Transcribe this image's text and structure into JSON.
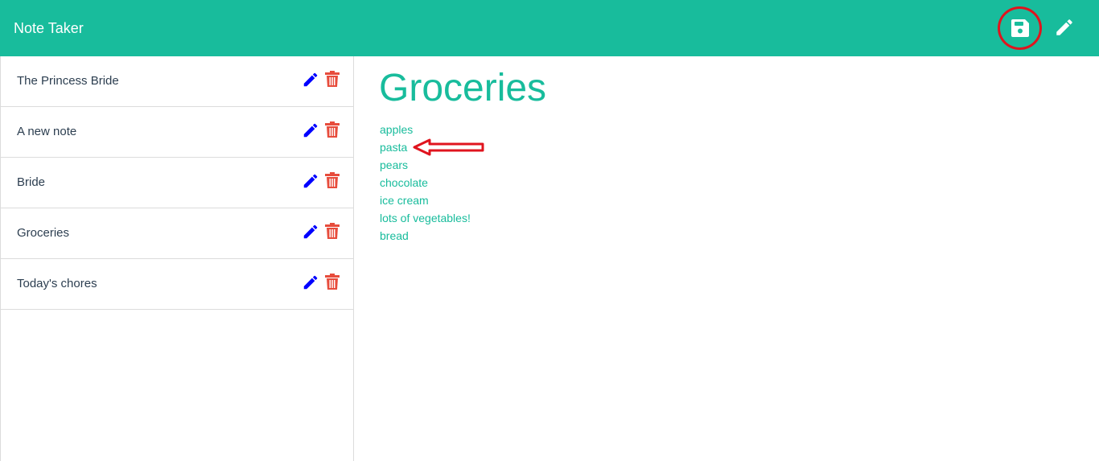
{
  "app": {
    "title": "Note Taker",
    "accent_color": "#18bc9c",
    "text_color": "#2c3e50",
    "edit_icon_color": "#0000ff",
    "delete_icon_color": "#e74c3c",
    "annotation_color": "#e0141e"
  },
  "navbar": {
    "save_icon": "floppy-disk-icon",
    "new_note_icon": "pencil-icon"
  },
  "sidebar": {
    "notes": [
      {
        "title": "The Princess Bride"
      },
      {
        "title": "A new note"
      },
      {
        "title": "Bride"
      },
      {
        "title": "Groceries"
      },
      {
        "title": "Today's chores"
      }
    ],
    "edit_icon": "pencil-icon",
    "delete_icon": "trash-icon"
  },
  "main": {
    "heading": "Groceries",
    "lines": [
      "apples",
      "pasta",
      "pears",
      "chocolate",
      "ice cream",
      "lots of vegetables!",
      "bread"
    ]
  }
}
